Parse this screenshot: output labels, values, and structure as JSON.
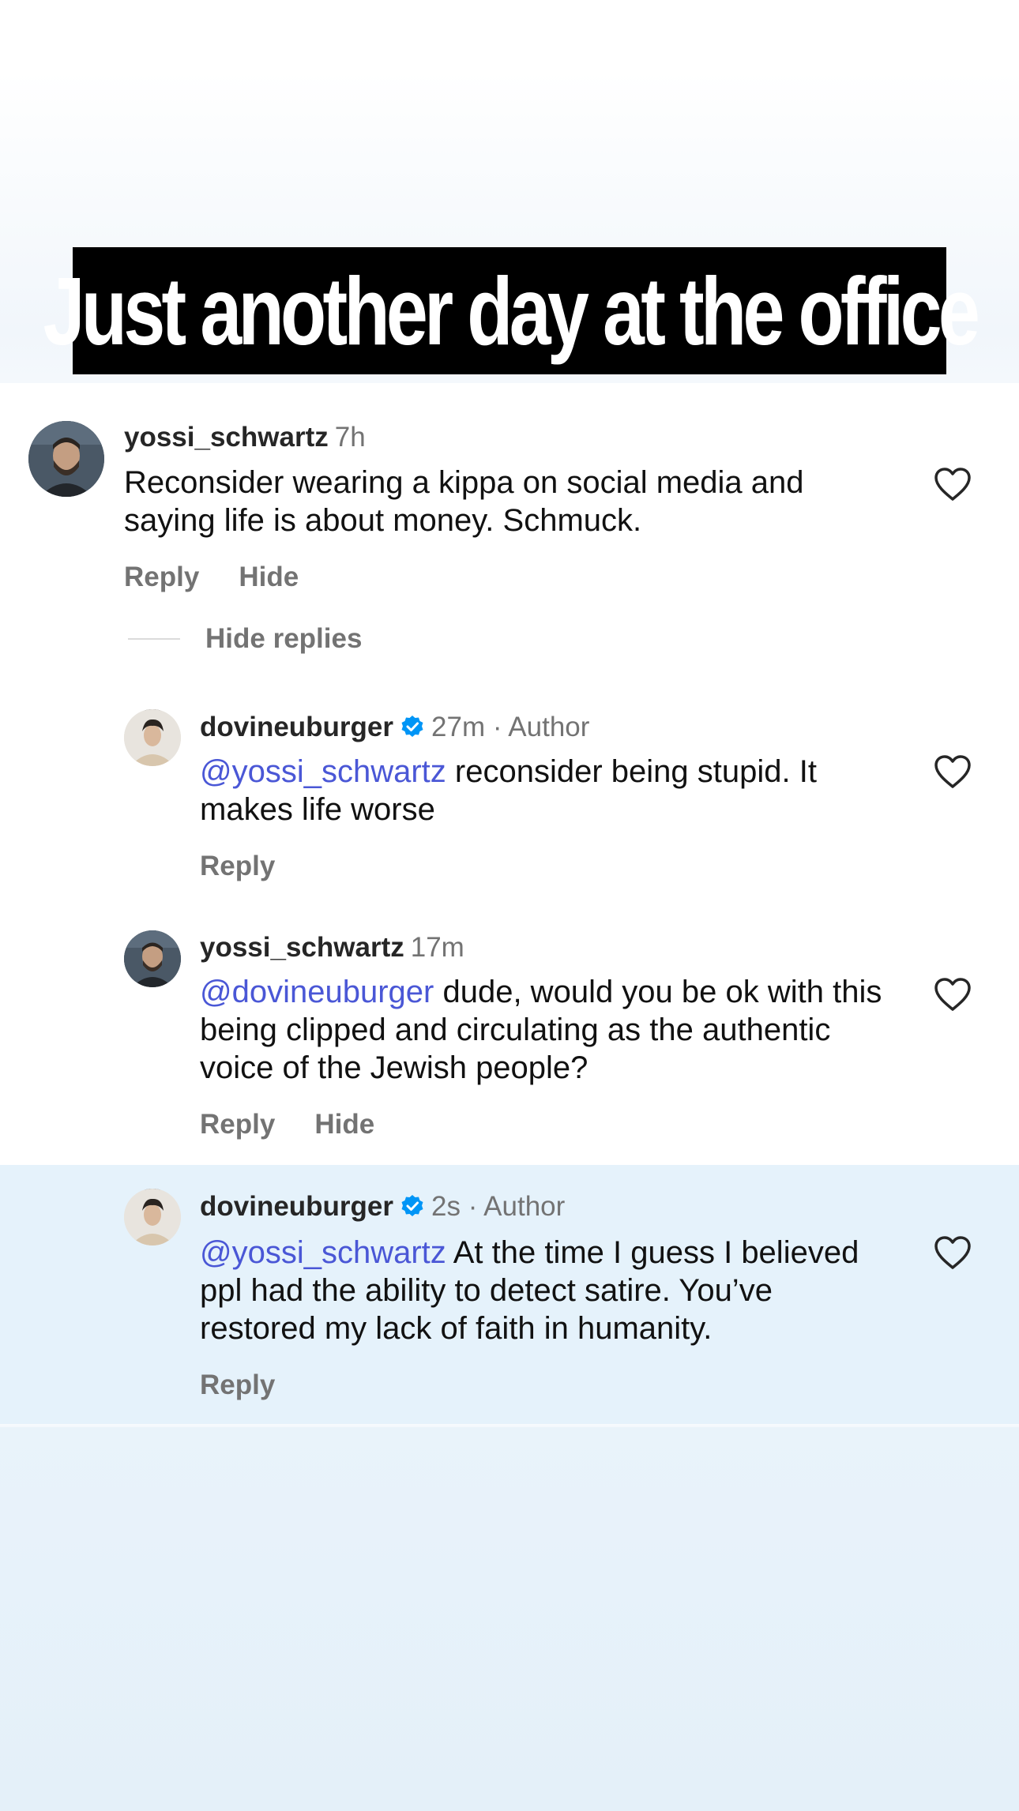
{
  "banner": {
    "text": "Just another day at the office"
  },
  "comments": [
    {
      "username": "yossi_schwartz",
      "time": "7h",
      "text": "Reconsider wearing a kippa on social media and saying life is about money. Schmuck.",
      "actions": [
        "Reply",
        "Hide"
      ]
    },
    {
      "username": "dovineuburger",
      "verified": true,
      "time": "27m · Author",
      "mention": "@yossi_schwartz",
      "text": " reconsider being stupid. It makes life worse",
      "actions": [
        "Reply"
      ]
    },
    {
      "username": "yossi_schwartz",
      "time": "17m",
      "mention": "@dovineuburger",
      "text": " dude, would you be ok with this being clipped and circulating as the authentic voice of the Jewish people?",
      "actions": [
        "Reply",
        "Hide"
      ]
    },
    {
      "username": "dovineuburger",
      "verified": true,
      "time": "2s · Author",
      "mention": "@yossi_schwartz",
      "text": " At the time I guess I believed ppl had the ability to detect satire. You’ve restored my lack of faith in humanity.",
      "actions": [
        "Reply"
      ]
    }
  ],
  "hide_replies_label": "Hide replies",
  "colors": {
    "mention": "#4a57d6",
    "verified": "#0095f6",
    "highlight": "#e5f2fb",
    "banner": "#000000"
  },
  "icons": {
    "like": "heart-outline-icon",
    "verified": "verified-badge-icon"
  }
}
